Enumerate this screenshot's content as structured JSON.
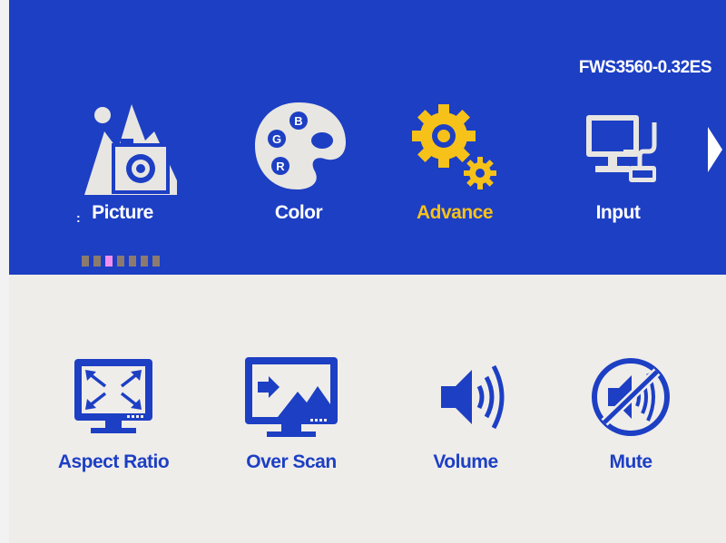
{
  "header": {
    "model": "FWS3560-0.32ES"
  },
  "menu": {
    "cursor": ":",
    "items": [
      {
        "label": "Picture",
        "icon": "picture-camera-icon"
      },
      {
        "label": "Color",
        "icon": "color-palette-icon"
      },
      {
        "label": "Advance",
        "icon": "gears-icon",
        "selected": true
      },
      {
        "label": "Input",
        "icon": "monitor-input-icon"
      }
    ],
    "page_count": 7,
    "active_page": 3
  },
  "submenu": {
    "items": [
      {
        "label": "Aspect Ratio",
        "icon": "aspect-ratio-icon"
      },
      {
        "label": "Over Scan",
        "icon": "over-scan-icon"
      },
      {
        "label": "Volume",
        "icon": "volume-icon"
      },
      {
        "label": "Mute",
        "icon": "mute-icon"
      }
    ]
  },
  "colors": {
    "panel_blue": "#1d3fc4",
    "selected_yellow": "#f6c21a",
    "bottom_background": "#efedea",
    "active_dot": "#f08ef0"
  }
}
